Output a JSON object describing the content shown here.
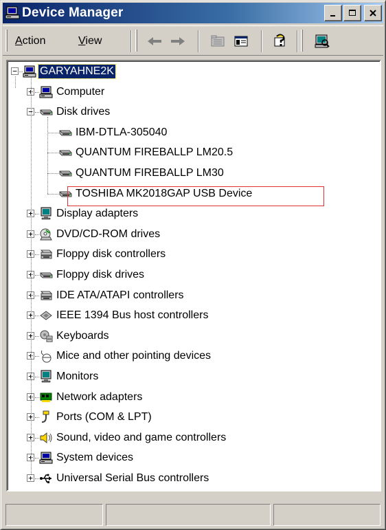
{
  "window": {
    "title": "Device Manager"
  },
  "menu": {
    "action_prefix": "",
    "action_u": "A",
    "action_rest": "ction",
    "view_u": "V",
    "view_rest": "iew"
  },
  "tree": {
    "root": "GARYAHNE2K",
    "categories": [
      {
        "label": "Computer",
        "icon": "computer-icon",
        "expanded": false
      },
      {
        "label": "Disk drives",
        "icon": "disk-drive-icon",
        "expanded": true,
        "children": [
          {
            "label": "IBM-DTLA-305040",
            "icon": "disk-drive-icon"
          },
          {
            "label": "QUANTUM FIREBALLP LM20.5",
            "icon": "disk-drive-icon"
          },
          {
            "label": "QUANTUM FIREBALLP LM30",
            "icon": "disk-drive-icon"
          },
          {
            "label": "TOSHIBA MK2018GAP USB Device",
            "icon": "disk-drive-icon",
            "highlighted": true
          }
        ]
      },
      {
        "label": "Display adapters",
        "icon": "monitor-icon",
        "expanded": false
      },
      {
        "label": "DVD/CD-ROM drives",
        "icon": "cdrom-icon",
        "expanded": false
      },
      {
        "label": "Floppy disk controllers",
        "icon": "controller-icon",
        "expanded": false
      },
      {
        "label": "Floppy disk drives",
        "icon": "disk-drive-icon",
        "expanded": false
      },
      {
        "label": "IDE ATA/ATAPI controllers",
        "icon": "controller-icon",
        "expanded": false
      },
      {
        "label": "IEEE 1394 Bus host controllers",
        "icon": "ieee1394-icon",
        "expanded": false
      },
      {
        "label": "Keyboards",
        "icon": "keyboard-icon",
        "expanded": false
      },
      {
        "label": "Mice and other pointing devices",
        "icon": "mouse-icon",
        "expanded": false
      },
      {
        "label": "Monitors",
        "icon": "monitor-icon",
        "expanded": false
      },
      {
        "label": "Network adapters",
        "icon": "network-adapter-icon",
        "expanded": false
      },
      {
        "label": "Ports (COM & LPT)",
        "icon": "port-icon",
        "expanded": false
      },
      {
        "label": "Sound, video and game controllers",
        "icon": "sound-icon",
        "expanded": false
      },
      {
        "label": "System devices",
        "icon": "computer-icon",
        "expanded": false
      },
      {
        "label": "Universal Serial Bus controllers",
        "icon": "usb-icon",
        "expanded": false
      }
    ]
  },
  "colors": {
    "title_gradient_start": "#0a246a",
    "title_gradient_end": "#a6caf0",
    "face": "#d4d0c8",
    "selection": "#0a246a",
    "highlight_box": "#e03030"
  }
}
